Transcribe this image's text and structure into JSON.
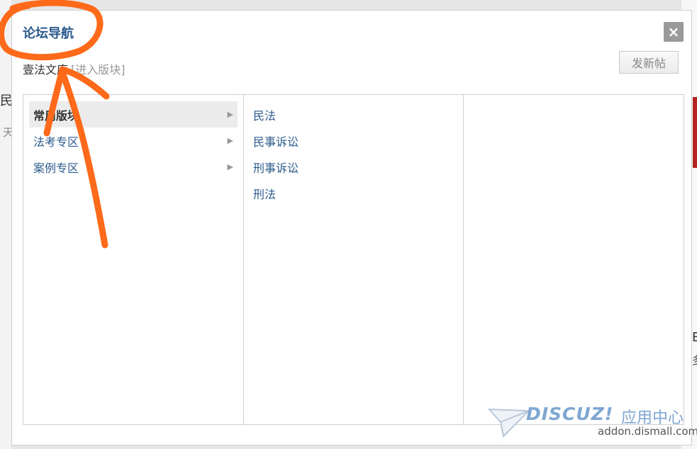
{
  "background": {
    "fragment_1": "民",
    "fragment_2": "天",
    "fragment_3": "E",
    "fragment_4": "多"
  },
  "dialog": {
    "title": "论坛导航",
    "close_label": "×",
    "forum_name": "壹法文库",
    "enter_link": "[进入版块]",
    "new_post_label": "发新帖"
  },
  "nav": {
    "categories": [
      {
        "label": "常用版块",
        "active": true
      },
      {
        "label": "法考专区",
        "active": false
      },
      {
        "label": "案例专区",
        "active": false
      }
    ],
    "forums": [
      "民法",
      "民事诉讼",
      "刑事诉讼",
      "刑法"
    ]
  },
  "watermark": {
    "logo": "DISCUZ!",
    "cn": "应用中心",
    "url": "addon.dismall.com"
  },
  "colors": {
    "link_blue": "#2c5a8c",
    "annotation_orange": "#ff6a1a"
  }
}
